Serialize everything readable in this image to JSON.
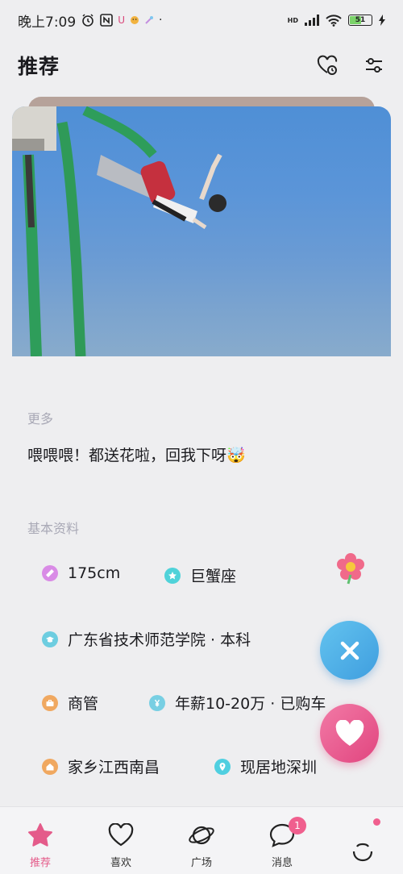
{
  "status_bar": {
    "time": "晚上7:09",
    "network": "HD",
    "battery": "51"
  },
  "header": {
    "title": "推荐"
  },
  "profile": {
    "photo_alt": "bungee jump photo",
    "more_label": "更多",
    "bio": "喂喂喂！都送花啦，回我下呀🤯",
    "basic_label": "基本资料",
    "info": {
      "height": "175cm",
      "zodiac": "巨蟹座",
      "school": "广东省技术师范学院 · 本科",
      "job": "商管",
      "income": "年薪10-20万 · 已购车",
      "hometown": "家乡江西南昌",
      "residence": "现居地深圳"
    }
  },
  "colors": {
    "accent": "#e45b8a",
    "like": "#e1457f",
    "dislike": "#3f9edf"
  },
  "tabs": [
    {
      "label": "推荐",
      "icon": "star-icon",
      "active": true
    },
    {
      "label": "喜欢",
      "icon": "heart-outline-icon"
    },
    {
      "label": "广场",
      "icon": "planet-icon"
    },
    {
      "label": "消息",
      "icon": "chat-bubble-icon",
      "badge": "1"
    },
    {
      "label": "",
      "icon": "profile-icon"
    }
  ]
}
